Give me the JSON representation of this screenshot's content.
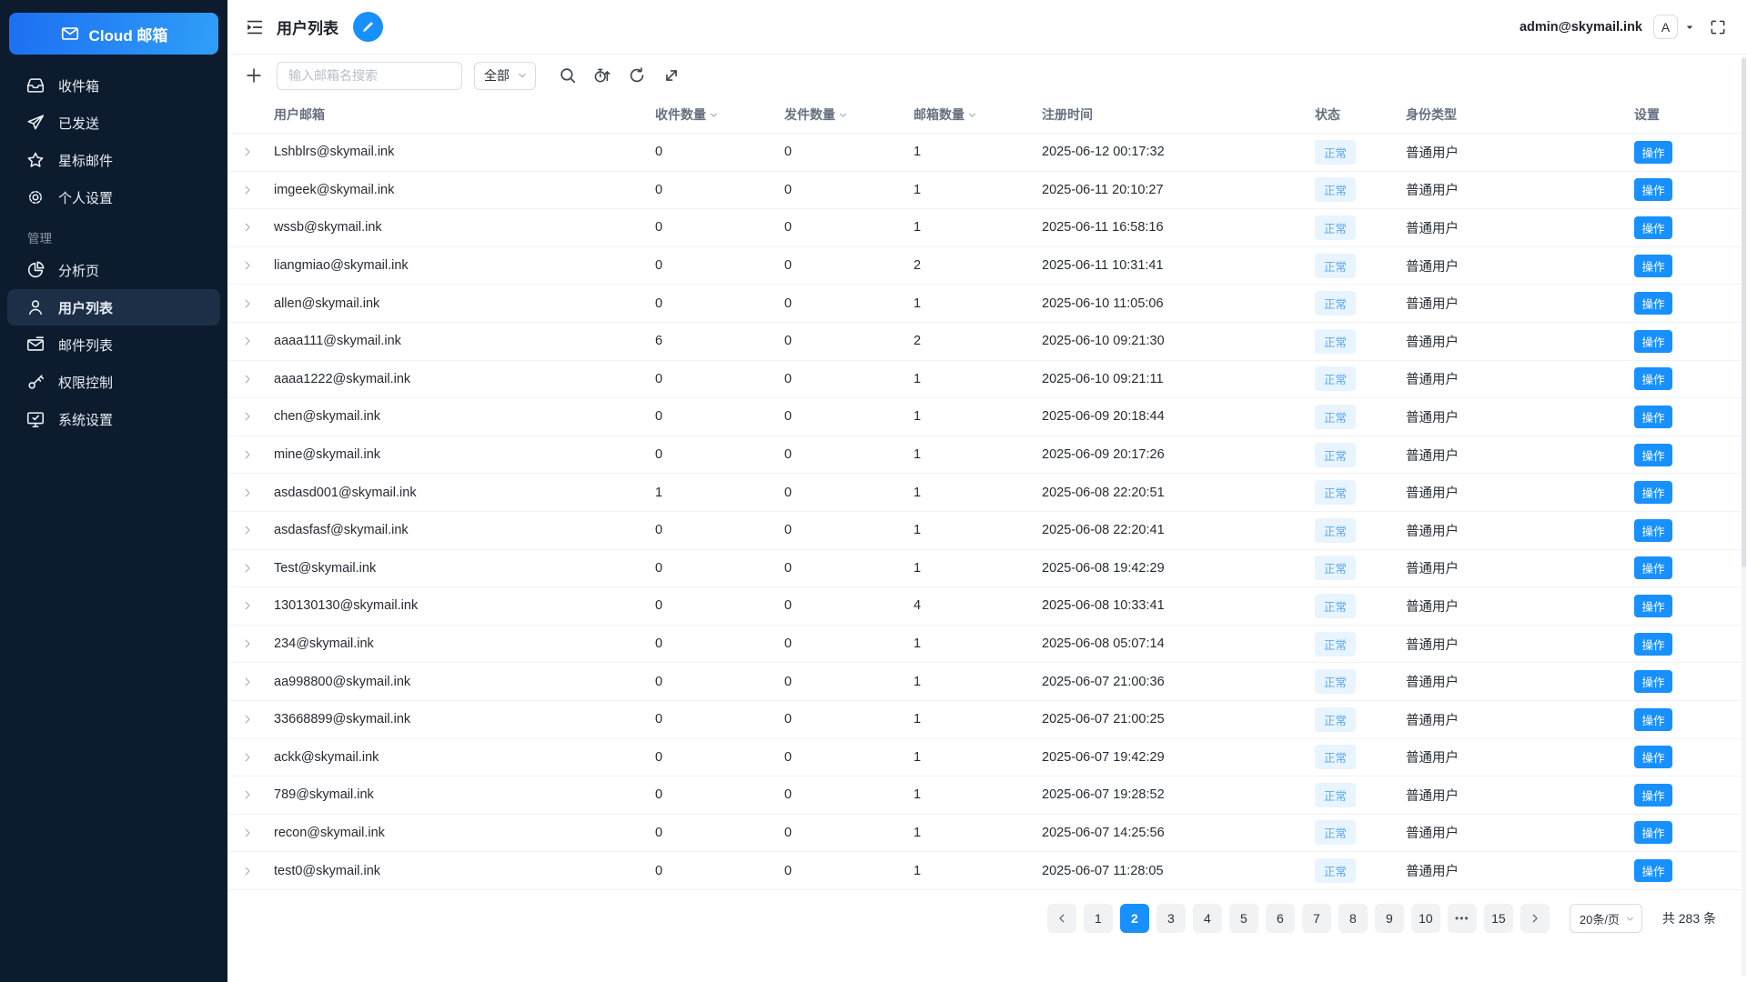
{
  "app": {
    "logo_text": "Cloud 邮箱"
  },
  "sidebar": {
    "sections": [
      {
        "items": [
          {
            "id": "inbox",
            "icon": "inbox",
            "label": "收件箱"
          },
          {
            "id": "sent",
            "icon": "send",
            "label": "已发送"
          },
          {
            "id": "starred",
            "icon": "star",
            "label": "星标邮件"
          },
          {
            "id": "personal-settings",
            "icon": "gear",
            "label": "个人设置"
          }
        ]
      },
      {
        "label": "管理",
        "items": [
          {
            "id": "analytics",
            "icon": "pie",
            "label": "分析页"
          },
          {
            "id": "user-list",
            "icon": "user",
            "label": "用户列表",
            "active": true
          },
          {
            "id": "mail-list",
            "icon": "mail",
            "label": "邮件列表"
          },
          {
            "id": "permissions",
            "icon": "key",
            "label": "权限控制"
          },
          {
            "id": "system-settings",
            "icon": "monitor",
            "label": "系统设置"
          }
        ]
      }
    ]
  },
  "header": {
    "page_title": "用户列表",
    "account_email": "admin@skymail.ink",
    "avatar_letter": "A"
  },
  "toolbar": {
    "search_placeholder": "输入邮箱名搜索",
    "filter_value": "全部"
  },
  "table": {
    "columns": [
      {
        "key": "email",
        "label": "用户邮箱"
      },
      {
        "key": "received",
        "label": "收件数量",
        "sortable": true
      },
      {
        "key": "sent",
        "label": "发件数量",
        "sortable": true
      },
      {
        "key": "mailboxes",
        "label": "邮箱数量",
        "sortable": true
      },
      {
        "key": "registered",
        "label": "注册时间"
      },
      {
        "key": "status",
        "label": "状态"
      },
      {
        "key": "type",
        "label": "身份类型"
      },
      {
        "key": "settings",
        "label": "设置"
      }
    ],
    "action_label": "操作",
    "rows": [
      {
        "email": "Lshblrs@skymail.ink",
        "received": "0",
        "sent": "0",
        "mailboxes": "1",
        "registered": "2025-06-12 00:17:32",
        "status": "正常",
        "type": "普通用户"
      },
      {
        "email": "imgeek@skymail.ink",
        "received": "0",
        "sent": "0",
        "mailboxes": "1",
        "registered": "2025-06-11 20:10:27",
        "status": "正常",
        "type": "普通用户"
      },
      {
        "email": "wssb@skymail.ink",
        "received": "0",
        "sent": "0",
        "mailboxes": "1",
        "registered": "2025-06-11 16:58:16",
        "status": "正常",
        "type": "普通用户"
      },
      {
        "email": "liangmiao@skymail.ink",
        "received": "0",
        "sent": "0",
        "mailboxes": "2",
        "registered": "2025-06-11 10:31:41",
        "status": "正常",
        "type": "普通用户"
      },
      {
        "email": "allen@skymail.ink",
        "received": "0",
        "sent": "0",
        "mailboxes": "1",
        "registered": "2025-06-10 11:05:06",
        "status": "正常",
        "type": "普通用户"
      },
      {
        "email": "aaaa111@skymail.ink",
        "received": "6",
        "sent": "0",
        "mailboxes": "2",
        "registered": "2025-06-10 09:21:30",
        "status": "正常",
        "type": "普通用户"
      },
      {
        "email": "aaaa1222@skymail.ink",
        "received": "0",
        "sent": "0",
        "mailboxes": "1",
        "registered": "2025-06-10 09:21:11",
        "status": "正常",
        "type": "普通用户"
      },
      {
        "email": "chen@skymail.ink",
        "received": "0",
        "sent": "0",
        "mailboxes": "1",
        "registered": "2025-06-09 20:18:44",
        "status": "正常",
        "type": "普通用户"
      },
      {
        "email": "mine@skymail.ink",
        "received": "0",
        "sent": "0",
        "mailboxes": "1",
        "registered": "2025-06-09 20:17:26",
        "status": "正常",
        "type": "普通用户"
      },
      {
        "email": "asdasd001@skymail.ink",
        "received": "1",
        "sent": "0",
        "mailboxes": "1",
        "registered": "2025-06-08 22:20:51",
        "status": "正常",
        "type": "普通用户"
      },
      {
        "email": "asdasfasf@skymail.ink",
        "received": "0",
        "sent": "0",
        "mailboxes": "1",
        "registered": "2025-06-08 22:20:41",
        "status": "正常",
        "type": "普通用户"
      },
      {
        "email": "Test@skymail.ink",
        "received": "0",
        "sent": "0",
        "mailboxes": "1",
        "registered": "2025-06-08 19:42:29",
        "status": "正常",
        "type": "普通用户"
      },
      {
        "email": "130130130@skymail.ink",
        "received": "0",
        "sent": "0",
        "mailboxes": "4",
        "registered": "2025-06-08 10:33:41",
        "status": "正常",
        "type": "普通用户"
      },
      {
        "email": "234@skymail.ink",
        "received": "0",
        "sent": "0",
        "mailboxes": "1",
        "registered": "2025-06-08 05:07:14",
        "status": "正常",
        "type": "普通用户"
      },
      {
        "email": "aa998800@skymail.ink",
        "received": "0",
        "sent": "0",
        "mailboxes": "1",
        "registered": "2025-06-07 21:00:36",
        "status": "正常",
        "type": "普通用户"
      },
      {
        "email": "33668899@skymail.ink",
        "received": "0",
        "sent": "0",
        "mailboxes": "1",
        "registered": "2025-06-07 21:00:25",
        "status": "正常",
        "type": "普通用户"
      },
      {
        "email": "ackk@skymail.ink",
        "received": "0",
        "sent": "0",
        "mailboxes": "1",
        "registered": "2025-06-07 19:42:29",
        "status": "正常",
        "type": "普通用户"
      },
      {
        "email": "789@skymail.ink",
        "received": "0",
        "sent": "0",
        "mailboxes": "1",
        "registered": "2025-06-07 19:28:52",
        "status": "正常",
        "type": "普通用户"
      },
      {
        "email": "recon@skymail.ink",
        "received": "0",
        "sent": "0",
        "mailboxes": "1",
        "registered": "2025-06-07 14:25:56",
        "status": "正常",
        "type": "普通用户"
      },
      {
        "email": "test0@skymail.ink",
        "received": "0",
        "sent": "0",
        "mailboxes": "1",
        "registered": "2025-06-07 11:28:05",
        "status": "正常",
        "type": "普通用户"
      }
    ]
  },
  "pagination": {
    "pages": [
      "1",
      "2",
      "3",
      "4",
      "5",
      "6",
      "7",
      "8",
      "9",
      "10",
      "•••",
      "15"
    ],
    "active_page": "2",
    "page_size": "20条/页",
    "total_text": "共 283 条"
  },
  "colors": {
    "primary": "#1890ff",
    "sidebar_bg": "#0d1b2e",
    "sidebar_active_bg": "#1d2e47",
    "badge_bg": "#e8f4ff",
    "badge_text": "#58a9f4",
    "logo_grad_start": "#1d6ff2",
    "logo_grad_end": "#2f9ff8"
  }
}
